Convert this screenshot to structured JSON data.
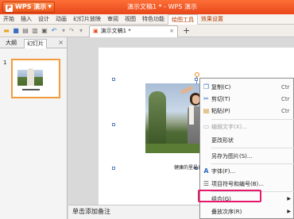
{
  "app": {
    "app_button": "WPS 演示",
    "window_title": "演示文稿1 * - WPS 演示"
  },
  "menubar": {
    "items": [
      "开始",
      "插入",
      "设计",
      "动画",
      "幻灯片放映",
      "审阅",
      "视图",
      "特色功能",
      "绘图工具",
      "效果设置"
    ]
  },
  "tabs": {
    "document": "演示文稿1 *"
  },
  "left_panel": {
    "tab_outline": "大纲",
    "tab_slides": "幻灯片",
    "slide_number": "1"
  },
  "slide": {
    "caption": "健康的里最自能"
  },
  "notes": {
    "placeholder": "单击添加备注"
  },
  "context_menu": {
    "items": [
      {
        "label": "复制(C)",
        "shortcut": "Ctr",
        "icon": "copy-icon",
        "disabled": false
      },
      {
        "label": "剪切(T)",
        "shortcut": "Ctr",
        "icon": "cut-icon",
        "disabled": false
      },
      {
        "label": "粘贴(P)",
        "shortcut": "Ctr",
        "icon": "paste-icon",
        "disabled": false
      },
      {
        "label": "编辑文字(X)...",
        "shortcut": "",
        "icon": "edit-text-icon",
        "disabled": true
      },
      {
        "label": "更改形状",
        "shortcut": "",
        "icon": "",
        "disabled": false
      },
      {
        "label": "另存为图片(S)...",
        "shortcut": "",
        "icon": "",
        "disabled": false
      },
      {
        "label": "字体(F)...",
        "shortcut": "",
        "icon": "font-icon",
        "disabled": false
      },
      {
        "label": "项目符号和编号(B)...",
        "shortcut": "",
        "icon": "bullets-icon",
        "disabled": false
      },
      {
        "label": "组合(G)",
        "shortcut": "",
        "icon": "",
        "disabled": false
      },
      {
        "label": "叠放次序(R)",
        "shortcut": "",
        "icon": "",
        "disabled": false
      }
    ]
  },
  "colors": {
    "titlebar": "#e8461a",
    "highlight_box": "#e5186a",
    "thumbnail_selected": "#f39c3d"
  }
}
